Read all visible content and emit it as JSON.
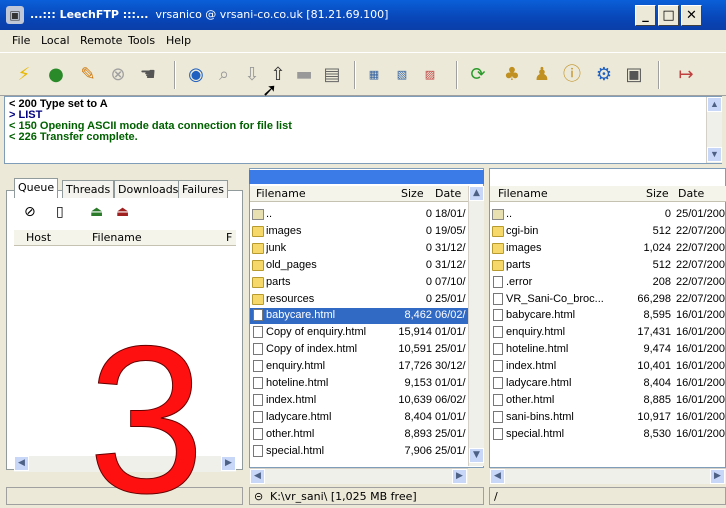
{
  "window": {
    "title_prefix": "...::: LeechFTP :::...",
    "title_rest": "vrsanico @ vrsani-co.co.uk [81.21.69.100]",
    "minimize": "_",
    "maximize": "□",
    "close": "✕"
  },
  "menu": [
    "File",
    "Local",
    "Remote",
    "Tools",
    "Help"
  ],
  "log": [
    "< 200 Type set to A",
    "> LIST",
    "< 150 Opening ASCII mode data connection for file list",
    "< 226 Transfer complete."
  ],
  "queue": {
    "tabs": [
      "Queue",
      "Threads",
      "Downloads",
      "Failures"
    ],
    "columns": [
      "Host",
      "Filename",
      "F"
    ]
  },
  "local": {
    "columns": [
      "Filename",
      "Size",
      "Date"
    ],
    "files": [
      {
        "name": "..",
        "size": "0",
        "date": "18/01/",
        "type": "up"
      },
      {
        "name": "images",
        "size": "0",
        "date": "19/05/",
        "type": "folder"
      },
      {
        "name": "junk",
        "size": "0",
        "date": "31/12/",
        "type": "folder"
      },
      {
        "name": "old_pages",
        "size": "0",
        "date": "31/12/",
        "type": "folder"
      },
      {
        "name": "parts",
        "size": "0",
        "date": "07/10/",
        "type": "folder"
      },
      {
        "name": "resources",
        "size": "0",
        "date": "25/01/",
        "type": "folder"
      },
      {
        "name": "babycare.html",
        "size": "8,462",
        "date": "06/02/",
        "type": "file",
        "selected": true
      },
      {
        "name": "Copy of enquiry.html",
        "size": "15,914",
        "date": "01/01/",
        "type": "file"
      },
      {
        "name": "Copy of index.html",
        "size": "10,591",
        "date": "25/01/",
        "type": "file"
      },
      {
        "name": "enquiry.html",
        "size": "17,726",
        "date": "30/12/",
        "type": "file"
      },
      {
        "name": "hoteline.html",
        "size": "9,153",
        "date": "01/01/",
        "type": "file"
      },
      {
        "name": "index.html",
        "size": "10,639",
        "date": "06/02/",
        "type": "file"
      },
      {
        "name": "ladycare.html",
        "size": "8,404",
        "date": "01/01/",
        "type": "file"
      },
      {
        "name": "other.html",
        "size": "8,893",
        "date": "25/01/",
        "type": "file"
      },
      {
        "name": "special.html",
        "size": "7,906",
        "date": "25/01/",
        "type": "file"
      }
    ],
    "status": "K:\\vr_sani\\  [1,025 MB free]"
  },
  "remote": {
    "columns": [
      "Filename",
      "Size",
      "Date"
    ],
    "files": [
      {
        "name": "..",
        "size": "0",
        "date": "25/01/200",
        "type": "up"
      },
      {
        "name": "cgi-bin",
        "size": "512",
        "date": "22/07/200",
        "type": "folder"
      },
      {
        "name": "images",
        "size": "1,024",
        "date": "22/07/200",
        "type": "folder"
      },
      {
        "name": "parts",
        "size": "512",
        "date": "22/07/200",
        "type": "folder"
      },
      {
        "name": ".error",
        "size": "208",
        "date": "22/07/200",
        "type": "file"
      },
      {
        "name": "VR_Sani-Co_broc...",
        "size": "66,298",
        "date": "22/07/200",
        "type": "file"
      },
      {
        "name": "babycare.html",
        "size": "8,595",
        "date": "16/01/200",
        "type": "file"
      },
      {
        "name": "enquiry.html",
        "size": "17,431",
        "date": "16/01/200",
        "type": "file"
      },
      {
        "name": "hoteline.html",
        "size": "9,474",
        "date": "16/01/200",
        "type": "file"
      },
      {
        "name": "index.html",
        "size": "10,401",
        "date": "16/01/200",
        "type": "file"
      },
      {
        "name": "ladycare.html",
        "size": "8,404",
        "date": "16/01/200",
        "type": "file"
      },
      {
        "name": "other.html",
        "size": "8,885",
        "date": "16/01/200",
        "type": "file"
      },
      {
        "name": "sani-bins.html",
        "size": "10,917",
        "date": "16/01/200",
        "type": "file"
      },
      {
        "name": "special.html",
        "size": "8,530",
        "date": "16/01/200",
        "type": "file"
      }
    ],
    "status": "/"
  },
  "overlay_digit": "3",
  "colors": {
    "titlebar": "#0846b8",
    "selection": "#316ac5",
    "overlay": "#ff1010"
  }
}
